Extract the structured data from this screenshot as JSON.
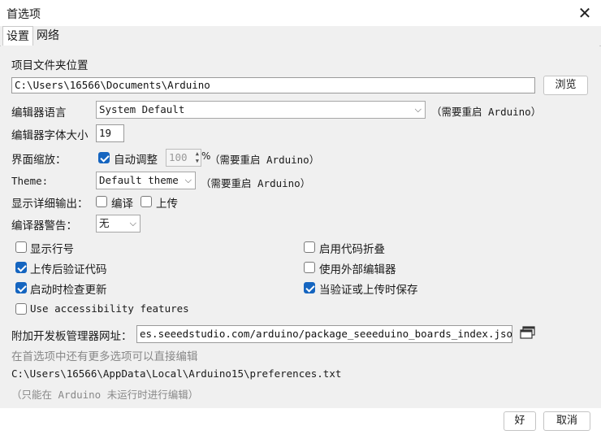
{
  "window": {
    "title": "首选项"
  },
  "tabs": [
    {
      "label": "设置"
    },
    {
      "label": "网络"
    }
  ],
  "sketchbook": {
    "label": "项目文件夹位置",
    "value": "C:\\Users\\16566\\Documents\\Arduino",
    "browse": "浏览"
  },
  "editor_language": {
    "label": "编辑器语言",
    "value": "System Default",
    "note": "（需要重启 Arduino）"
  },
  "font_size": {
    "label": "编辑器字体大小",
    "value": "19"
  },
  "scale": {
    "label": "界面缩放：",
    "auto_label": "自动调整",
    "auto_checked": true,
    "value": "100",
    "unit": "%",
    "note": "（需要重启 Arduino）"
  },
  "theme": {
    "label": "Theme:",
    "value": "Default theme",
    "note": "（需要重启 Arduino）"
  },
  "verbose": {
    "label": "显示详细输出：",
    "compile": "编译",
    "upload": "上传"
  },
  "warnings": {
    "label": "编译器警告：",
    "value": "无"
  },
  "options": [
    {
      "label": "显示行号",
      "checked": false
    },
    {
      "label": "启用代码折叠",
      "checked": false
    },
    {
      "label": "上传后验证代码",
      "checked": true
    },
    {
      "label": "使用外部编辑器",
      "checked": false
    },
    {
      "label": "启动时检查更新",
      "checked": true
    },
    {
      "label": "当验证或上传时保存",
      "checked": true
    },
    {
      "label": "Use accessibility features",
      "checked": false
    }
  ],
  "board_urls": {
    "label": "附加开发板管理器网址：",
    "value": "es.seeedstudio.com/arduino/package_seeeduino_boards_index.json"
  },
  "more_prefs": "在首选项中还有更多选项可以直接编辑",
  "prefs_path": "C:\\Users\\16566\\AppData\\Local\\Arduino15\\preferences.txt",
  "prefs_note": "（只能在 Arduino 未运行时进行编辑）",
  "footer": {
    "ok": "好",
    "cancel": "取消"
  },
  "colors": {
    "accent": "#1565c0",
    "background": "#f0f0f0"
  },
  "icons": {
    "close": "close-icon",
    "window_edit": "window-icon",
    "dropdown": "chevron-down-icon"
  }
}
